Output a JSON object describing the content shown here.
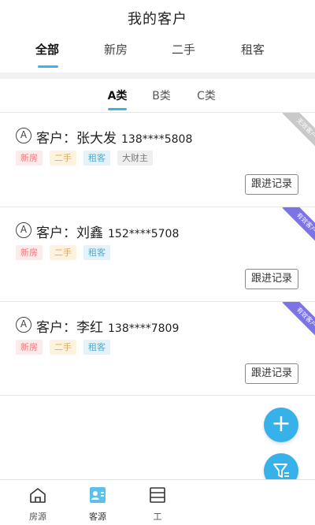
{
  "header": {
    "title": "我的客户",
    "tabs": [
      "全部",
      "新房",
      "二手",
      "租客"
    ]
  },
  "sub_tabs": [
    "A类",
    "B类",
    "C类"
  ],
  "customers": [
    {
      "grade": "A",
      "label": "客户：",
      "name": "张大发",
      "phone": "138****5808",
      "tags": [
        "新房",
        "二手",
        "租客",
        "大财主"
      ],
      "status": "无效客户",
      "follow_label": "跟进记录"
    },
    {
      "grade": "A",
      "label": "客户：",
      "name": "刘鑫",
      "phone": "152****5708",
      "tags": [
        "新房",
        "二手",
        "租客"
      ],
      "status": "有效客户",
      "follow_label": "跟进记录"
    },
    {
      "grade": "A",
      "label": "客户：",
      "name": "李红",
      "phone": "138****7809",
      "tags": [
        "新房",
        "二手",
        "租客"
      ],
      "status": "有效客户",
      "follow_label": "跟进记录"
    }
  ],
  "fab": {
    "add_icon": "plus-icon",
    "filter_icon": "filter-icon"
  },
  "tabbar": {
    "items": [
      {
        "label": "房源",
        "icon": "house-icon"
      },
      {
        "label": "客源",
        "icon": "contact-card-icon"
      },
      {
        "label": "工",
        "icon": "work-icon"
      }
    ]
  },
  "colors": {
    "accent": "#36b1ea",
    "valid_ribbon": "#7b73e6",
    "invalid_ribbon": "#c9c9c9"
  }
}
